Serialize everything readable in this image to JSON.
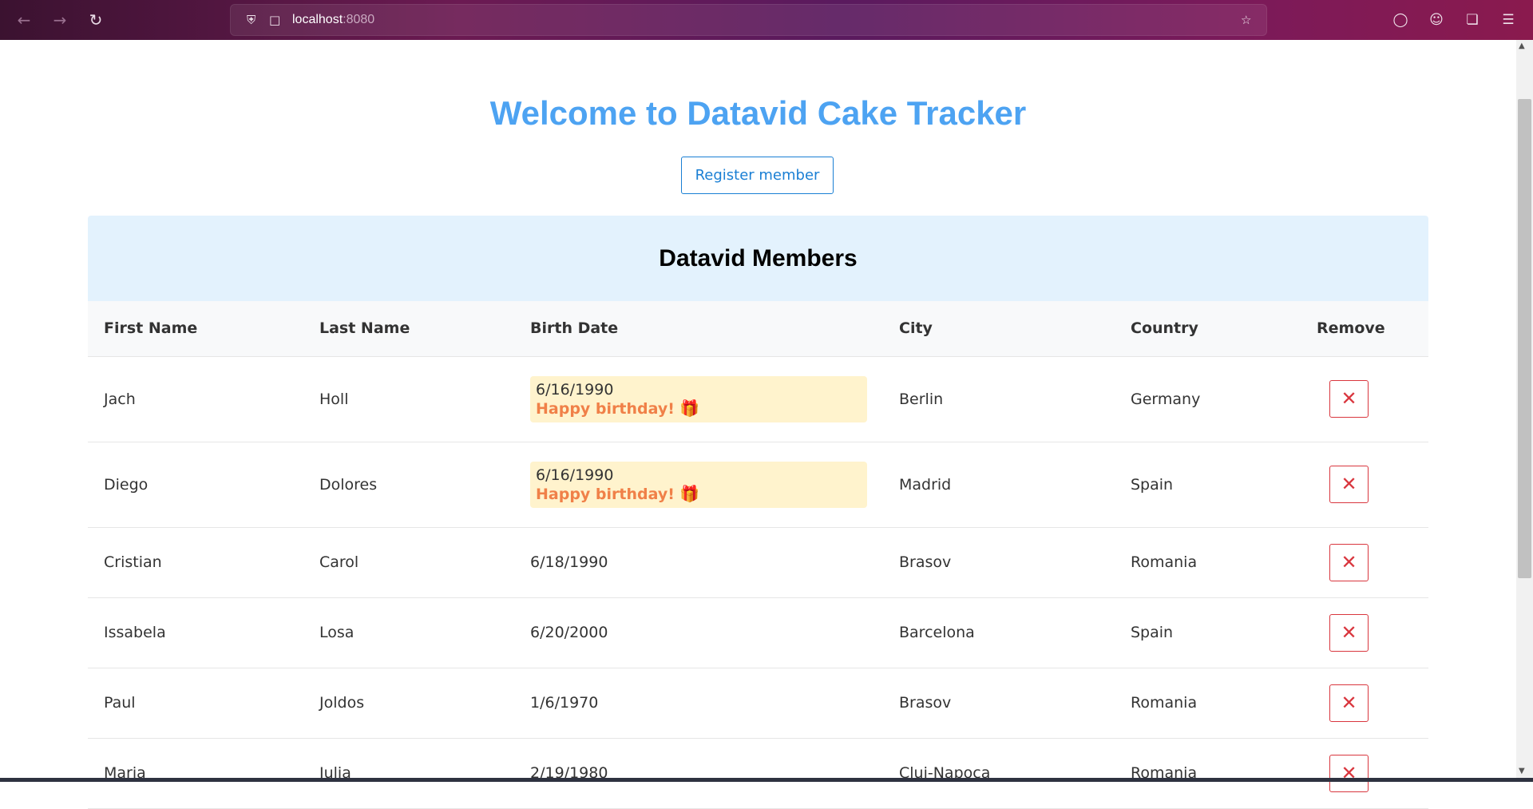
{
  "browser": {
    "url_host": "localhost",
    "url_port": ":8080"
  },
  "page": {
    "title": "Welcome to Datavid Cake Tracker",
    "register_label": "Register member",
    "section_title": "Datavid Members"
  },
  "table": {
    "headers": {
      "first_name": "First Name",
      "last_name": "Last Name",
      "birth_date": "Birth Date",
      "city": "City",
      "country": "Country",
      "remove": "Remove"
    },
    "birthday_message": "Happy birthday!",
    "remove_icon": "✕",
    "rows": [
      {
        "first": "Jach",
        "last": "Holl",
        "birth": "6/16/1990",
        "city": "Berlin",
        "country": "Germany",
        "birthday": true
      },
      {
        "first": "Diego",
        "last": "Dolores",
        "birth": "6/16/1990",
        "city": "Madrid",
        "country": "Spain",
        "birthday": true
      },
      {
        "first": "Cristian",
        "last": "Carol",
        "birth": "6/18/1990",
        "city": "Brasov",
        "country": "Romania",
        "birthday": false
      },
      {
        "first": "Issabela",
        "last": "Losa",
        "birth": "6/20/2000",
        "city": "Barcelona",
        "country": "Spain",
        "birthday": false
      },
      {
        "first": "Paul",
        "last": "Joldos",
        "birth": "1/6/1970",
        "city": "Brasov",
        "country": "Romania",
        "birthday": false
      },
      {
        "first": "Maria",
        "last": "Julia",
        "birth": "2/19/1980",
        "city": "Cluj-Napoca",
        "country": "Romania",
        "birthday": false
      }
    ]
  },
  "colors": {
    "title": "#4da3f2",
    "primary": "#1a7fd4",
    "danger": "#d9363e",
    "birthday_bg": "#fff3cd",
    "birthday_text": "#f08048",
    "section_bg": "#e3f2fd"
  }
}
